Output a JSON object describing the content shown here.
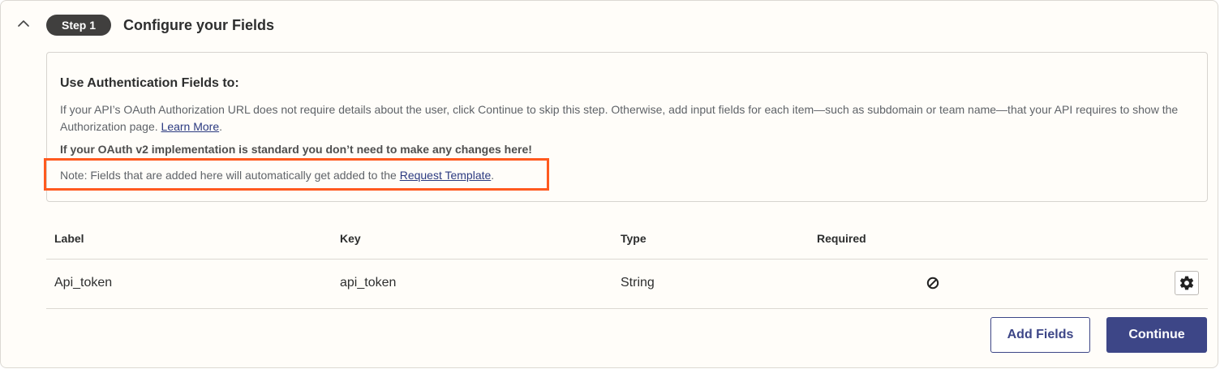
{
  "step": {
    "badge": "Step 1",
    "title": "Configure your Fields"
  },
  "info": {
    "heading": "Use Authentication Fields to:",
    "paragraph_before_link": "If your API’s OAuth Authorization URL does not require details about the user, click Continue to skip this step. Otherwise, add input fields for each item—such as subdomain or team name—that your API requires to show the Authorization page. ",
    "learn_more_link": "Learn More",
    "paragraph_after_link": ".",
    "bold_note": "If your OAuth v2 implementation is standard you don’t need to make any changes here!",
    "note_before_link": "Note: Fields that are added here will automatically get added to the ",
    "request_template_link": "Request Template",
    "note_after_link": "."
  },
  "table": {
    "headers": {
      "label": "Label",
      "key": "Key",
      "type": "Type",
      "required": "Required"
    },
    "rows": [
      {
        "label": "Api_token",
        "key": "api_token",
        "type": "String",
        "required_icon": "not-required-icon"
      }
    ]
  },
  "actions": {
    "add_fields": "Add Fields",
    "continue": "Continue"
  },
  "colors": {
    "primary": "#3d4687",
    "highlight": "#ff5a1f",
    "badge_bg": "#403f3e"
  }
}
